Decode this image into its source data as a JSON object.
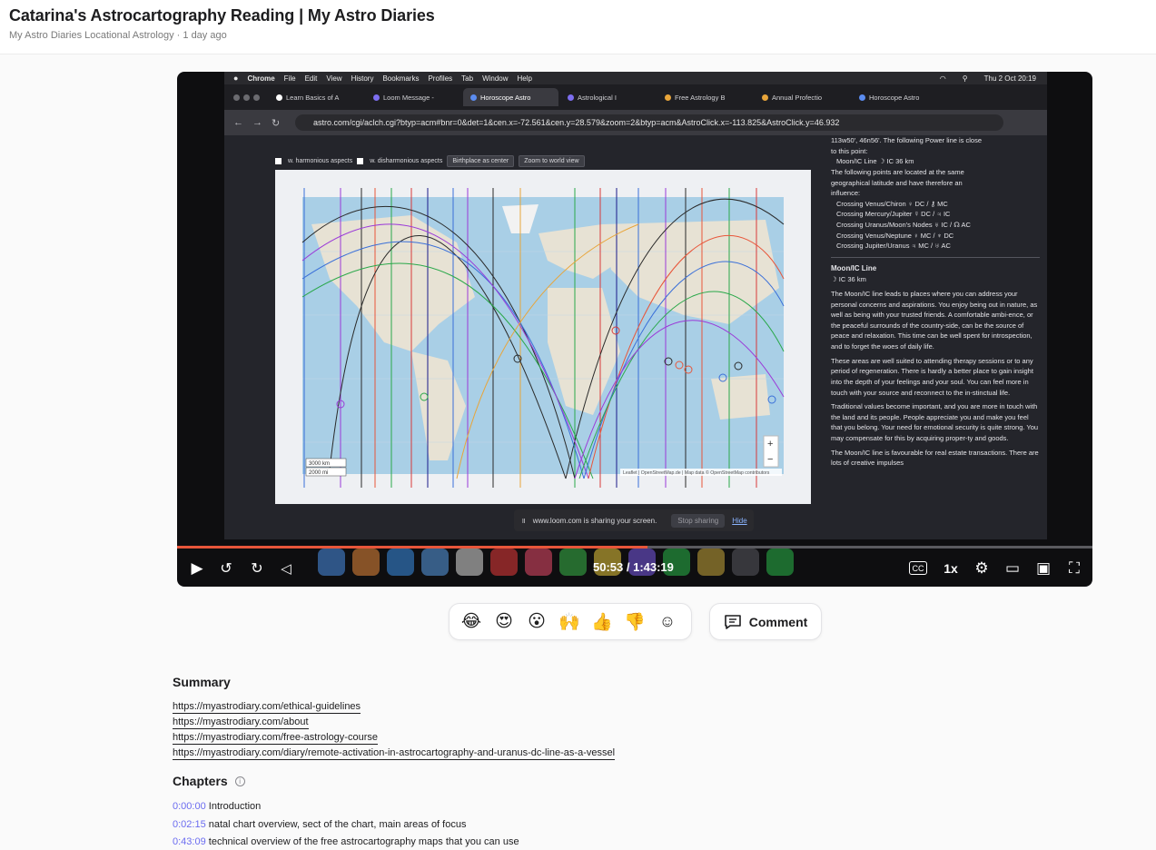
{
  "header": {
    "title": "Catarina's Astrocartography Reading | My Astro Diaries",
    "channel": "My Astro Diaries Locational Astrology",
    "separator": "·",
    "posted": "1 day ago"
  },
  "video": {
    "mac_menu": {
      "apple": "",
      "items": [
        "Chrome",
        "File",
        "Edit",
        "View",
        "History",
        "Bookmarks",
        "Profiles",
        "Tab",
        "Window",
        "Help"
      ],
      "clock": "Thu 2 Oct  20:19"
    },
    "tabs": [
      {
        "label": "Learn Basics of A",
        "active": false
      },
      {
        "label": "Loom Message -",
        "active": false
      },
      {
        "label": "Horoscope Astro",
        "active": true
      },
      {
        "label": "Astrological I",
        "active": false
      },
      {
        "label": "Free Astrology B",
        "active": false
      },
      {
        "label": "Annual Profectio",
        "active": false
      },
      {
        "label": "Horoscope Astro",
        "active": false
      }
    ],
    "url": "astro.com/cgi/aclch.cgi?btyp=acm#bnr=0&det=1&cen.x=-72.561&cen.y=28.579&zoom=2&btyp=acm&AstroClick.x=-113.825&AstroClick.y=46.932",
    "map_controls": {
      "harmonious": "w. harmonious aspects",
      "disharmonious": "w. disharmonious aspects",
      "birthplace": "Birthplace as center",
      "zoom": "Zoom to world view"
    },
    "map_scale": [
      "3000 km",
      "2000 mi"
    ],
    "map_attribution": "Leaflet | OpenStreetMap.de | Map data © OpenStreetMap contributors",
    "panel": {
      "intro": [
        "113w50', 46n56'. The following Power line is close",
        "to this point:",
        "Moon/IC Line ☽ IC  36 km",
        "The following points are located at the same",
        "geographical latitude and have therefore an",
        "influence:"
      ],
      "crossings": [
        "Crossing Venus/Chiron ♀ DC / ⚷ MC",
        "Crossing Mercury/Jupiter ☿ DC / ♃ IC",
        "Crossing Uranus/Moon's Nodes ♅ IC / ☊ AC",
        "Crossing Venus/Neptune ♀ MC / ♆ DC",
        "Crossing Jupiter/Uranus ♃ MC / ♅ AC"
      ],
      "heading": "Moon/IC Line",
      "subheading": "☽ IC  36 km",
      "paragraphs": [
        "The Moon/IC line leads to places where you can address your personal concerns and aspirations. You enjoy being out in nature, as well as being with your trusted friends. A comfortable ambi-ence, or the peaceful surrounds of the country-side, can be the source of peace and relaxation. This time can be well spent for introspection, and to forget the woes of daily life.",
        "These areas are well suited to attending therapy sessions or to any period of regeneration. There is hardly a better place to gain insight into the depth of your feelings and your soul. You can feel more in touch with your source and reconnect to the in-stinctual life.",
        "Traditional values become important, and you are more in touch with the land and its people. People appreciate you and make you feel that you belong. Your need for emotional security is quite strong. You may compensate for this by acquiring proper-ty and goods.",
        "The Moon/IC line is favourable for real estate transactions. There are lots of creative impulses"
      ]
    },
    "share_bar": {
      "text": "www.loom.com is sharing your screen.",
      "stop": "Stop sharing",
      "hide": "Hide"
    },
    "progress_fraction": 0.514,
    "time": "50:53 / 1:43:19",
    "speed": "1x"
  },
  "reactions": [
    "😂",
    "😍",
    "😮",
    "🙌",
    "👍",
    "👎"
  ],
  "comment_label": "Comment",
  "summary": {
    "heading": "Summary",
    "links": [
      "https://myastrodiary.com/ethical-guidelines",
      "https://myastrodiary.com/about",
      "https://myastrodiary.com/free-astrology-course",
      "https://myastrodiary.com/diary/remote-activation-in-astrocartography-and-uranus-dc-line-as-a-vessel"
    ]
  },
  "chapters": {
    "heading": "Chapters",
    "items": [
      {
        "time": "0:00:00",
        "title": "Introduction"
      },
      {
        "time": "0:02:15",
        "title": "natal chart overview, sect of the chart, main areas of focus"
      },
      {
        "time": "0:43:09",
        "title": "technical overview of the free astrocartography maps that you can use"
      }
    ]
  },
  "colors": {
    "accent": "#e8563a",
    "timestamp": "#6b6cf0"
  }
}
